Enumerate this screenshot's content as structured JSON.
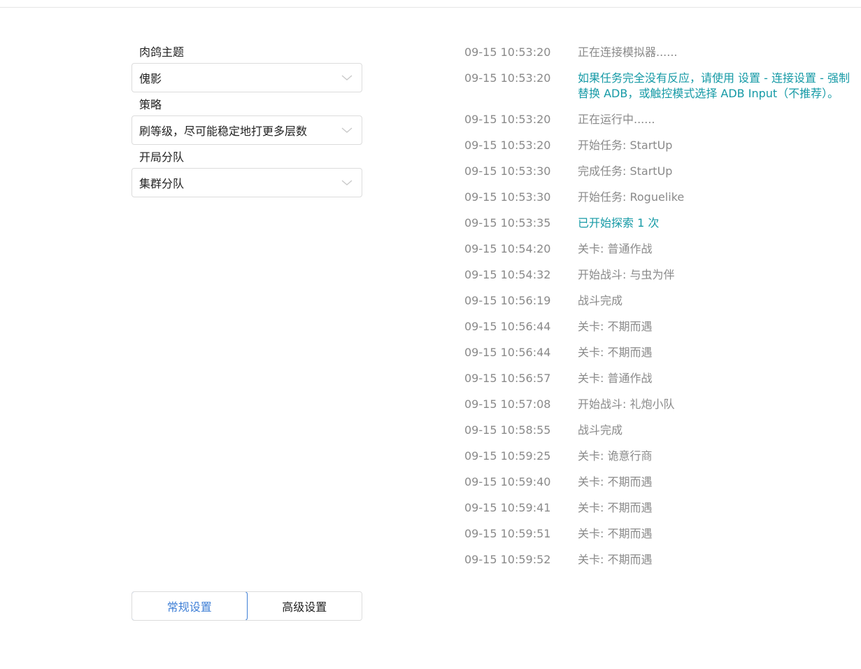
{
  "settings": {
    "theme_label": "肉鸽主题",
    "theme_value": "傀影",
    "strategy_label": "策略",
    "strategy_value": "刷等级，尽可能稳定地打更多层数",
    "squad_label": "开局分队",
    "squad_value": "集群分队"
  },
  "tabs": {
    "general": "常规设置",
    "advanced": "高级设置"
  },
  "log": [
    {
      "time": "09-15  10:53:20",
      "msg": "正在连接模拟器......",
      "type": "normal"
    },
    {
      "time": "09-15  10:53:20",
      "msg": "如果任务完全没有反应，请使用 设置 - 连接设置 - 强制替换 ADB，或触控模式选择 ADB Input（不推荐）。",
      "type": "info"
    },
    {
      "time": "09-15  10:53:20",
      "msg": "正在运行中......",
      "type": "normal"
    },
    {
      "time": "09-15  10:53:20",
      "msg": "开始任务: StartUp",
      "type": "normal"
    },
    {
      "time": "09-15  10:53:30",
      "msg": "完成任务: StartUp",
      "type": "normal"
    },
    {
      "time": "09-15  10:53:30",
      "msg": "开始任务: Roguelike",
      "type": "normal"
    },
    {
      "time": "09-15  10:53:35",
      "msg": "已开始探索 1 次",
      "type": "info"
    },
    {
      "time": "09-15  10:54:20",
      "msg": "关卡: 普通作战",
      "type": "normal"
    },
    {
      "time": "09-15  10:54:32",
      "msg": "开始战斗: 与虫为伴",
      "type": "normal"
    },
    {
      "time": "09-15  10:56:19",
      "msg": "战斗完成",
      "type": "normal"
    },
    {
      "time": "09-15  10:56:44",
      "msg": "关卡: 不期而遇",
      "type": "normal"
    },
    {
      "time": "09-15  10:56:44",
      "msg": "关卡: 不期而遇",
      "type": "normal"
    },
    {
      "time": "09-15  10:56:57",
      "msg": "关卡: 普通作战",
      "type": "normal"
    },
    {
      "time": "09-15  10:57:08",
      "msg": "开始战斗: 礼炮小队",
      "type": "normal"
    },
    {
      "time": "09-15  10:58:55",
      "msg": "战斗完成",
      "type": "normal"
    },
    {
      "time": "09-15  10:59:25",
      "msg": "关卡: 诡意行商",
      "type": "normal"
    },
    {
      "time": "09-15  10:59:40",
      "msg": "关卡: 不期而遇",
      "type": "normal"
    },
    {
      "time": "09-15  10:59:41",
      "msg": "关卡: 不期而遇",
      "type": "normal"
    },
    {
      "time": "09-15  10:59:51",
      "msg": "关卡: 不期而遇",
      "type": "normal"
    },
    {
      "time": "09-15  10:59:52",
      "msg": "关卡: 不期而遇",
      "type": "normal"
    }
  ],
  "colors": {
    "info": "#169aa6",
    "muted": "#8a8a8a",
    "accent": "#3f7fd6"
  }
}
